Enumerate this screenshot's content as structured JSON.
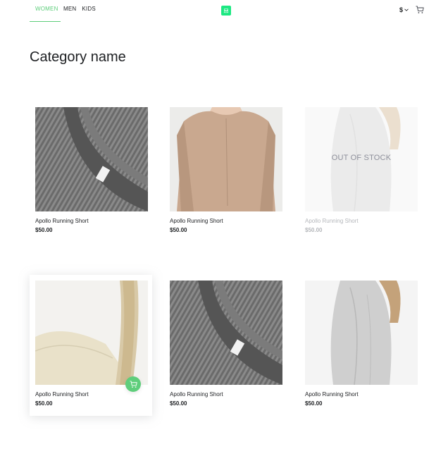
{
  "header": {
    "tabs": [
      {
        "label": "WOMEN"
      },
      {
        "label": "MEN"
      },
      {
        "label": "KIDS"
      }
    ],
    "currency_symbol": "$",
    "accent_color": "#5ece7b",
    "logo_color": "#1de882"
  },
  "page": {
    "title": "Category name"
  },
  "products": [
    {
      "name": "Apollo Running Short",
      "price": "$50.00",
      "image": "grey-knit-sweater"
    },
    {
      "name": "Apollo Running Short",
      "price": "$50.00",
      "image": "beige-sweater"
    },
    {
      "name": "Apollo Running Short",
      "price": "$50.00",
      "image": "white-dress",
      "out_of_stock_label": "OUT OF STOCK"
    },
    {
      "name": "Apollo Running Short",
      "price": "$50.00",
      "image": "canvas-tote-bag"
    },
    {
      "name": "Apollo Running Short",
      "price": "$50.00",
      "image": "grey-knit-sweater"
    },
    {
      "name": "Apollo Running Short",
      "price": "$50.00",
      "image": "white-dress"
    }
  ]
}
